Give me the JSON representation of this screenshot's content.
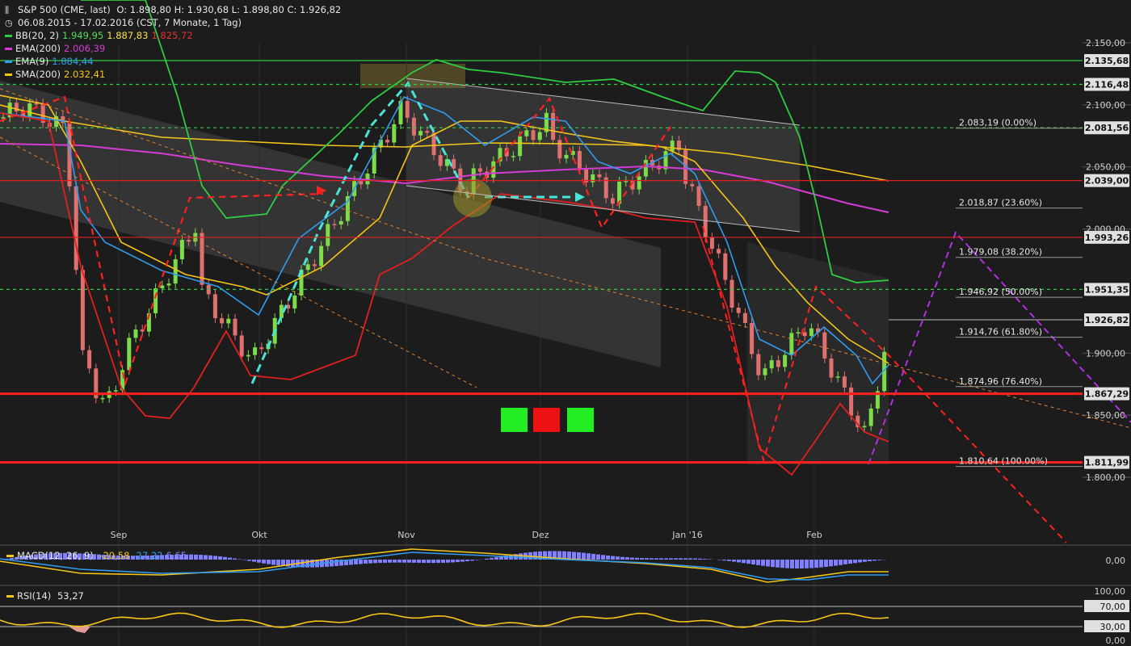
{
  "header": {
    "instrument": "S&P 500 (CME, last)",
    "ohlc": "O: 1.898,80  H: 1.930,68  L: 1.898,80  C: 1.926,82",
    "range": "06.08.2015 - 17.02.2016 (CST, 7 Monate, 1 Tag)",
    "chart_icon": "bar-chart-icon",
    "clock_icon": "clock-icon"
  },
  "indicators": [
    {
      "name": "BB(20, 2)",
      "values": [
        "1.949,95",
        "1.887,83",
        "1.825,72"
      ],
      "value_colors": [
        "#55dd55",
        "#f5e04a",
        "#e83030"
      ],
      "color": "#2ecc40"
    },
    {
      "name": "EMA(200)",
      "values": [
        "2.006,39"
      ],
      "value_colors": [
        "#d63bd6"
      ],
      "color": "#d63bd6"
    },
    {
      "name": "EMA(9)",
      "values": [
        "1.884,44"
      ],
      "value_colors": [
        "#2f9cf0"
      ],
      "color": "#2f9cf0"
    },
    {
      "name": "SMA(200)",
      "values": [
        "2.032,41"
      ],
      "value_colors": [
        "#f5c518"
      ],
      "color": "#f5c518"
    }
  ],
  "macd": {
    "name": "MACD(12, 26, 9)",
    "values": [
      "-20,58",
      "-27,22",
      "6,65"
    ],
    "value_colors": [
      "#f5c518",
      "#2f9cf0",
      "#8888ff"
    ],
    "axis_label": "0,00"
  },
  "rsi": {
    "name": "RSI(14)",
    "value": "53,27",
    "axis_labels": [
      "100,00",
      "70,00",
      "30,00",
      "0,00"
    ]
  },
  "chart_data": {
    "type": "candlestick",
    "title": "S&P 500 (CME, last)",
    "x_axis_labels": [
      "Sep",
      "Okt",
      "Nov",
      "Dez",
      "Jan '16",
      "Feb"
    ],
    "y_axis_labels": [
      "2.150,00",
      "2.100,00",
      "2.050,00",
      "2.000,00",
      "1.900,00",
      "1.850,00",
      "1.800,00"
    ],
    "ylim": [
      1780,
      2170
    ],
    "horizontal_levels": [
      {
        "price": 2135.68,
        "label": "2.135,68",
        "color": "#2ecc40",
        "style": "solid"
      },
      {
        "price": 2116.48,
        "label": "2.116,48",
        "color": "#2ecc40",
        "style": "dashed"
      },
      {
        "price": 2081.56,
        "label": "2.081,56",
        "color": "#2ecc40",
        "style": "dashed"
      },
      {
        "price": 2039.0,
        "label": "2.039,00",
        "color": "#e02020",
        "style": "solid"
      },
      {
        "price": 1993.26,
        "label": "1.993,26",
        "color": "#e02020",
        "style": "solid"
      },
      {
        "price": 1951.35,
        "label": "1.951,35",
        "color": "#2ecc40",
        "style": "dashed"
      },
      {
        "price": 1926.82,
        "label": "1.926,82",
        "color": "#bbbbbb",
        "style": "last"
      },
      {
        "price": 1867.29,
        "label": "1.867,29",
        "color": "#ff2020",
        "style": "thick"
      },
      {
        "price": 1811.99,
        "label": "1.811,99",
        "color": "#ff2020",
        "style": "thick"
      }
    ],
    "fibonacci": [
      {
        "price": 2083.19,
        "label": "2.083,19 (0.00%)"
      },
      {
        "price": 2018.87,
        "label": "2.018,87 (23.60%)"
      },
      {
        "price": 1979.08,
        "label": "1.979,08 (38.20%)"
      },
      {
        "price": 1946.92,
        "label": "1.946,92 (50.00%)"
      },
      {
        "price": 1914.76,
        "label": "1.914,76 (61.80%)"
      },
      {
        "price": 1874.96,
        "label": "1.874,96 (76.40%)"
      },
      {
        "price": 1810.64,
        "label": "1.810,64 (100.00%)"
      }
    ],
    "colors": {
      "up": "#7ddc4a",
      "down": "#e07070",
      "grid": "#3a3a3a",
      "text": "#cfcfcf"
    },
    "series": [
      {
        "name": "BB(20, 2)",
        "color": "#2ecc40"
      },
      {
        "name": "EMA(200)",
        "color": "#d63bd6"
      },
      {
        "name": "EMA(9)",
        "color": "#2f9cf0"
      },
      {
        "name": "SMA(200)",
        "color": "#f5c518"
      }
    ]
  }
}
